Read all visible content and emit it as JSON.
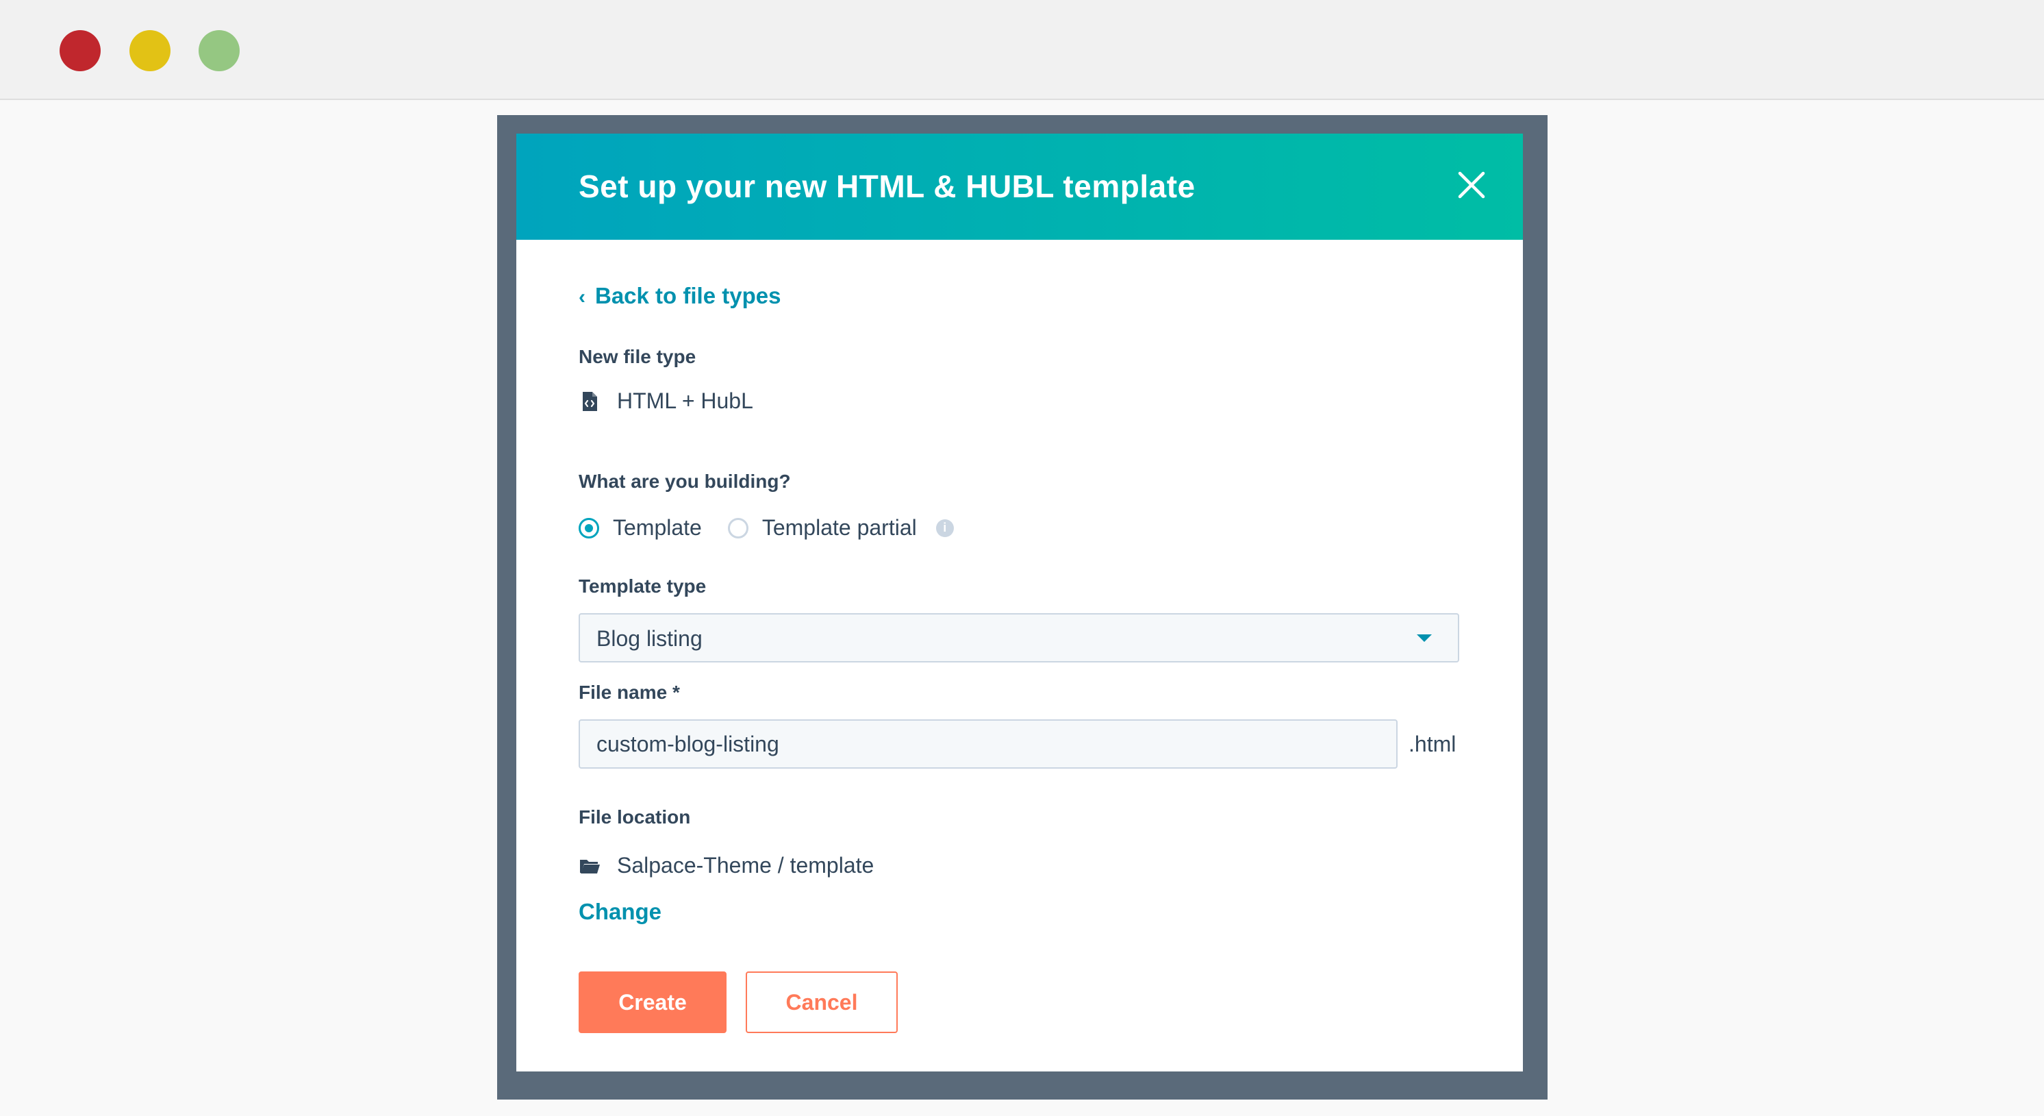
{
  "window": {
    "traffic_lights": [
      {
        "name": "close",
        "color": "#c0272d"
      },
      {
        "name": "minimize",
        "color": "#e2c215"
      },
      {
        "name": "maximize",
        "color": "#95c782"
      }
    ]
  },
  "modal": {
    "title": "Set up your new HTML & HUBL template",
    "close_icon": "close-icon",
    "back_link": "Back to file types",
    "back_icon": "chevron-left-icon",
    "file_type": {
      "label": "New file type",
      "icon": "code-file-icon",
      "value": "HTML + HubL"
    },
    "building": {
      "label": "What are you building?",
      "options": [
        {
          "label": "Template",
          "checked": true
        },
        {
          "label": "Template partial",
          "checked": false
        }
      ],
      "info_icon": "info-icon"
    },
    "template_type": {
      "label": "Template type",
      "selected": "Blog listing",
      "dropdown_icon": "caret-down-icon"
    },
    "file_name": {
      "label": "File name *",
      "value": "custom-blog-listing",
      "suffix": ".html"
    },
    "file_location": {
      "label": "File location",
      "icon": "folder-open-icon",
      "value": "Salpace-Theme / template",
      "change_link": "Change"
    },
    "buttons": {
      "create": "Create",
      "cancel": "Cancel"
    }
  },
  "colors": {
    "header_gradient_start": "#00a4bd",
    "header_gradient_end": "#00bda5",
    "link": "#0091ae",
    "primary_button": "#ff7a59",
    "overlay": "#5a6a7a",
    "text": "#33475b"
  }
}
